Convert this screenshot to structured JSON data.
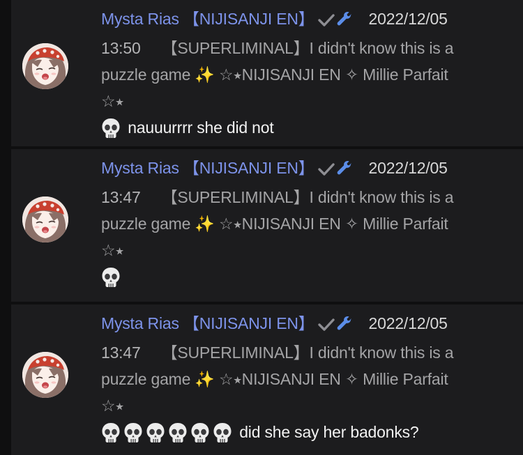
{
  "comments": [
    {
      "author": "Mysta Rias 【NIJISANJI EN】",
      "date": "2022/12/05",
      "time": "13:50",
      "video_title_line1": "【SUPERLIMINAL】I didn't know this is a",
      "video_title_line2": "puzzle game ✨ ☆⭑NIJISANJI EN ✧ Millie Parfait",
      "video_title_line3": "☆⭑",
      "skull_count": 1,
      "text": "nauuurrrr she did not"
    },
    {
      "author": "Mysta Rias 【NIJISANJI EN】",
      "date": "2022/12/05",
      "time": "13:47",
      "video_title_line1": "【SUPERLIMINAL】I didn't know this is a",
      "video_title_line2": "puzzle game ✨ ☆⭑NIJISANJI EN ✧ Millie Parfait",
      "video_title_line3": "☆⭑",
      "skull_count": 1,
      "text": ""
    },
    {
      "author": "Mysta Rias 【NIJISANJI EN】",
      "date": "2022/12/05",
      "time": "13:47",
      "video_title_line1": "【SUPERLIMINAL】I didn't know this is a",
      "video_title_line2": "puzzle game ✨ ☆⭑NIJISANJI EN ✧ Millie Parfait",
      "video_title_line3": "☆⭑",
      "skull_count": 6,
      "text": "did she say her badonks?"
    }
  ],
  "icons": {
    "verified": "check-icon",
    "moderator": "wrench-icon",
    "emoji": "skull-emoji"
  },
  "colors": {
    "author": "#7d93ea",
    "wrench": "#5b8de8",
    "check": "#8e8e93",
    "background": "#0f0f10",
    "card": "#1c1c1e"
  }
}
